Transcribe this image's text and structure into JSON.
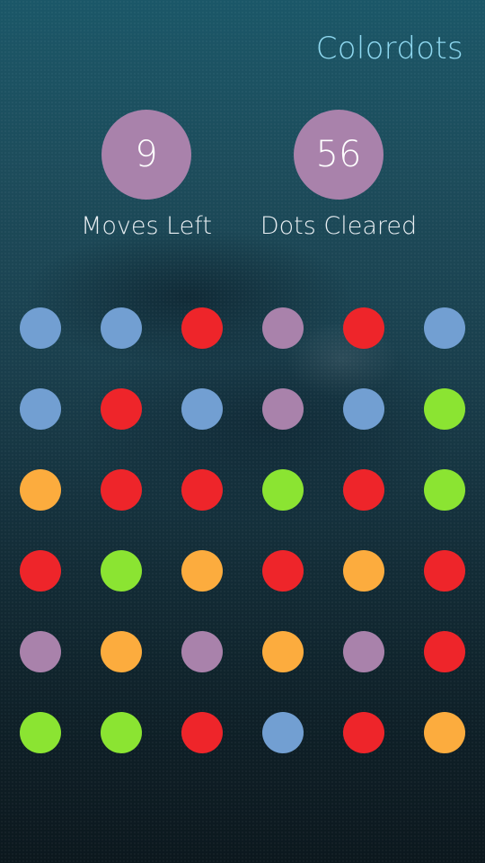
{
  "app": {
    "title": "Colordots"
  },
  "stats": {
    "moves_left": {
      "value": "9",
      "label": "Moves Left"
    },
    "dots_cleared": {
      "value": "56",
      "label": "Dots Cleared"
    }
  },
  "colors": {
    "blue": "#729fd2",
    "red": "#ee252a",
    "purple": "#a982ab",
    "green": "#8be432",
    "orange": "#fcac3e",
    "stat_circle": "#a982ab",
    "title_text": "#8fd8f0"
  },
  "board": {
    "columns": 6,
    "rows": [
      [
        "blue",
        "blue",
        "red",
        "purple",
        "red",
        "blue"
      ],
      [
        "blue",
        "red",
        "blue",
        "purple",
        "blue",
        "green"
      ],
      [
        "orange",
        "red",
        "red",
        "green",
        "red",
        "green"
      ],
      [
        "red",
        "green",
        "orange",
        "red",
        "orange",
        "red"
      ],
      [
        "purple",
        "orange",
        "purple",
        "orange",
        "purple",
        "red"
      ],
      [
        "green",
        "green",
        "red",
        "blue",
        "red",
        "orange"
      ]
    ]
  }
}
